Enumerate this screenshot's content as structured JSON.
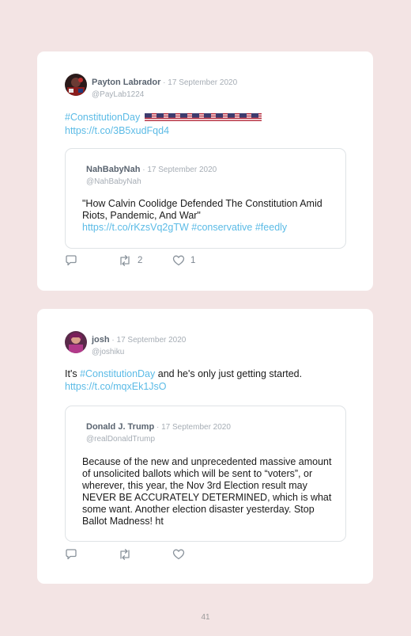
{
  "tweets": [
    {
      "author_name": "Payton Labrador",
      "separator": " · ",
      "date": "17 September 2020",
      "handle": "@PayLab1224",
      "hashtag": "#ConstitutionDay",
      "emoji_label": "🇺🇸🇺🇸🇺🇸🇺🇸🇺🇸🇺🇸🇺🇸🇺🇸🇺🇸🇺🇸",
      "link": "https://t.co/3B5xudFqd4",
      "quote": {
        "author_name": "NahBabyNah",
        "separator": " · ",
        "date": "17 September 2020",
        "handle": "@NahBabyNah",
        "text": "\"How Calvin Coolidge Defended The Constitution Amid Riots, Pandemic, And War\"",
        "link": "https://t.co/rKzsVq2gTW",
        "hashtag1": "#conservative",
        "hashtag2": "#feedly"
      },
      "retweets": "2",
      "likes": "1"
    },
    {
      "author_name": "josh",
      "separator": " · ",
      "date": "17 September 2020",
      "handle": "@joshiku",
      "text_before": "It's ",
      "hashtag": "#ConstitutionDay",
      "text_after": " and he's only just getting started.",
      "link": "https://t.co/mqxEk1JsO",
      "quote": {
        "author_name": "Donald J. Trump",
        "separator": " · ",
        "date": "17 September 2020",
        "handle": "@realDonaldTrump",
        "text": "Because of the new and unprecedented massive amount of unsolicited ballots which will be sent to “voters”, or wherever, this year, the Nov 3rd Election result may NEVER BE ACCURATELY DETERMINED, which is what some want. Another election disaster yesterday. Stop Ballot Madness! ht"
      }
    }
  ],
  "page_number": "41",
  "colors": {
    "background": "#f3e4e4",
    "link": "#5bbbe6",
    "muted": "#a6adb5"
  },
  "icons": [
    "reply-icon",
    "retweet-icon",
    "like-icon",
    "avatar-payton",
    "avatar-josh",
    "us-flag-icon"
  ]
}
